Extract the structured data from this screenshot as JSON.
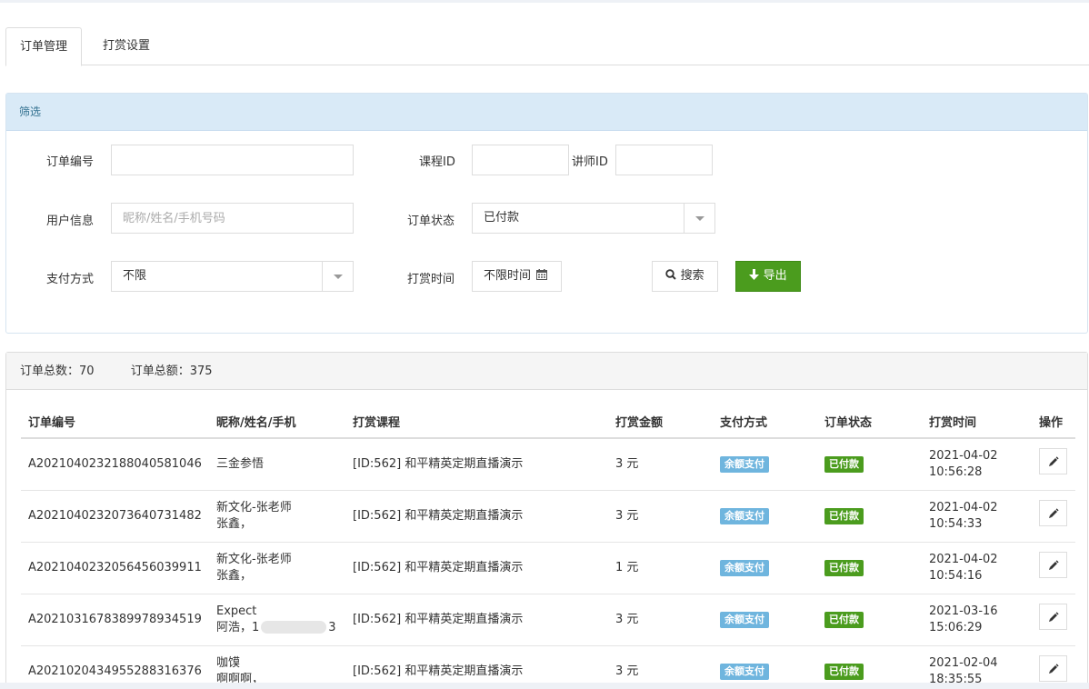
{
  "tabs": [
    {
      "label": "订单管理",
      "active": true
    },
    {
      "label": "打赏设置",
      "active": false
    }
  ],
  "filter": {
    "title": "筛选",
    "order_no_label": "订单编号",
    "order_no_value": "",
    "course_id_label": "课程ID",
    "course_id_value": "",
    "teacher_id_label": "讲师ID",
    "teacher_id_value": "",
    "user_info_label": "用户信息",
    "user_info_placeholder": "昵称/姓名/手机号码",
    "order_status_label": "订单状态",
    "order_status_value": "已付款",
    "pay_method_label": "支付方式",
    "pay_method_value": "不限",
    "reward_time_label": "打赏时间",
    "reward_time_value": "不限时间",
    "search_label": "搜索",
    "export_label": "导出"
  },
  "summary": {
    "total_orders": "订单总数：70",
    "total_amount": "订单总额：375"
  },
  "table": {
    "headers": [
      "订单编号",
      "昵称/姓名/手机",
      "打赏课程",
      "打赏金额",
      "支付方式",
      "订单状态",
      "打赏时间",
      "操作"
    ],
    "rows": [
      {
        "order_no": "A2021040232188040581046",
        "user_line1": "三金参悟",
        "user_line2": "",
        "course": "[ID:562] 和平精英定期直播演示",
        "amount": "3 元",
        "pay": "余额支付",
        "status": "已付款",
        "date": "2021-04-02",
        "time": "10:56:28"
      },
      {
        "order_no": "A2021040232073640731482",
        "user_line1": "新文化-张老师",
        "user_line2": "张鑫，",
        "course": "[ID:562] 和平精英定期直播演示",
        "amount": "3 元",
        "pay": "余额支付",
        "status": "已付款",
        "date": "2021-04-02",
        "time": "10:54:33"
      },
      {
        "order_no": "A2021040232056456039911",
        "user_line1": "新文化-张老师",
        "user_line2": "张鑫，",
        "course": "[ID:562] 和平精英定期直播演示",
        "amount": "1 元",
        "pay": "余额支付",
        "status": "已付款",
        "date": "2021-04-02",
        "time": "10:54:16"
      },
      {
        "order_no": "A2021031678389978934519",
        "user_line1": "Expect",
        "user_line2": "阿浩，1",
        "user_line2_tail": "3",
        "course": "[ID:562] 和平精英定期直播演示",
        "amount": "3 元",
        "pay": "余额支付",
        "status": "已付款",
        "date": "2021-03-16",
        "time": "15:06:29"
      },
      {
        "order_no": "A2021020434955288316376",
        "user_line1": "咖馍",
        "user_line2": "啊啊啊，",
        "course": "[ID:562] 和平精英定期直播演示",
        "amount": "3 元",
        "pay": "余额支付",
        "status": "已付款",
        "date": "2021-02-04",
        "time": "18:35:55"
      }
    ]
  }
}
